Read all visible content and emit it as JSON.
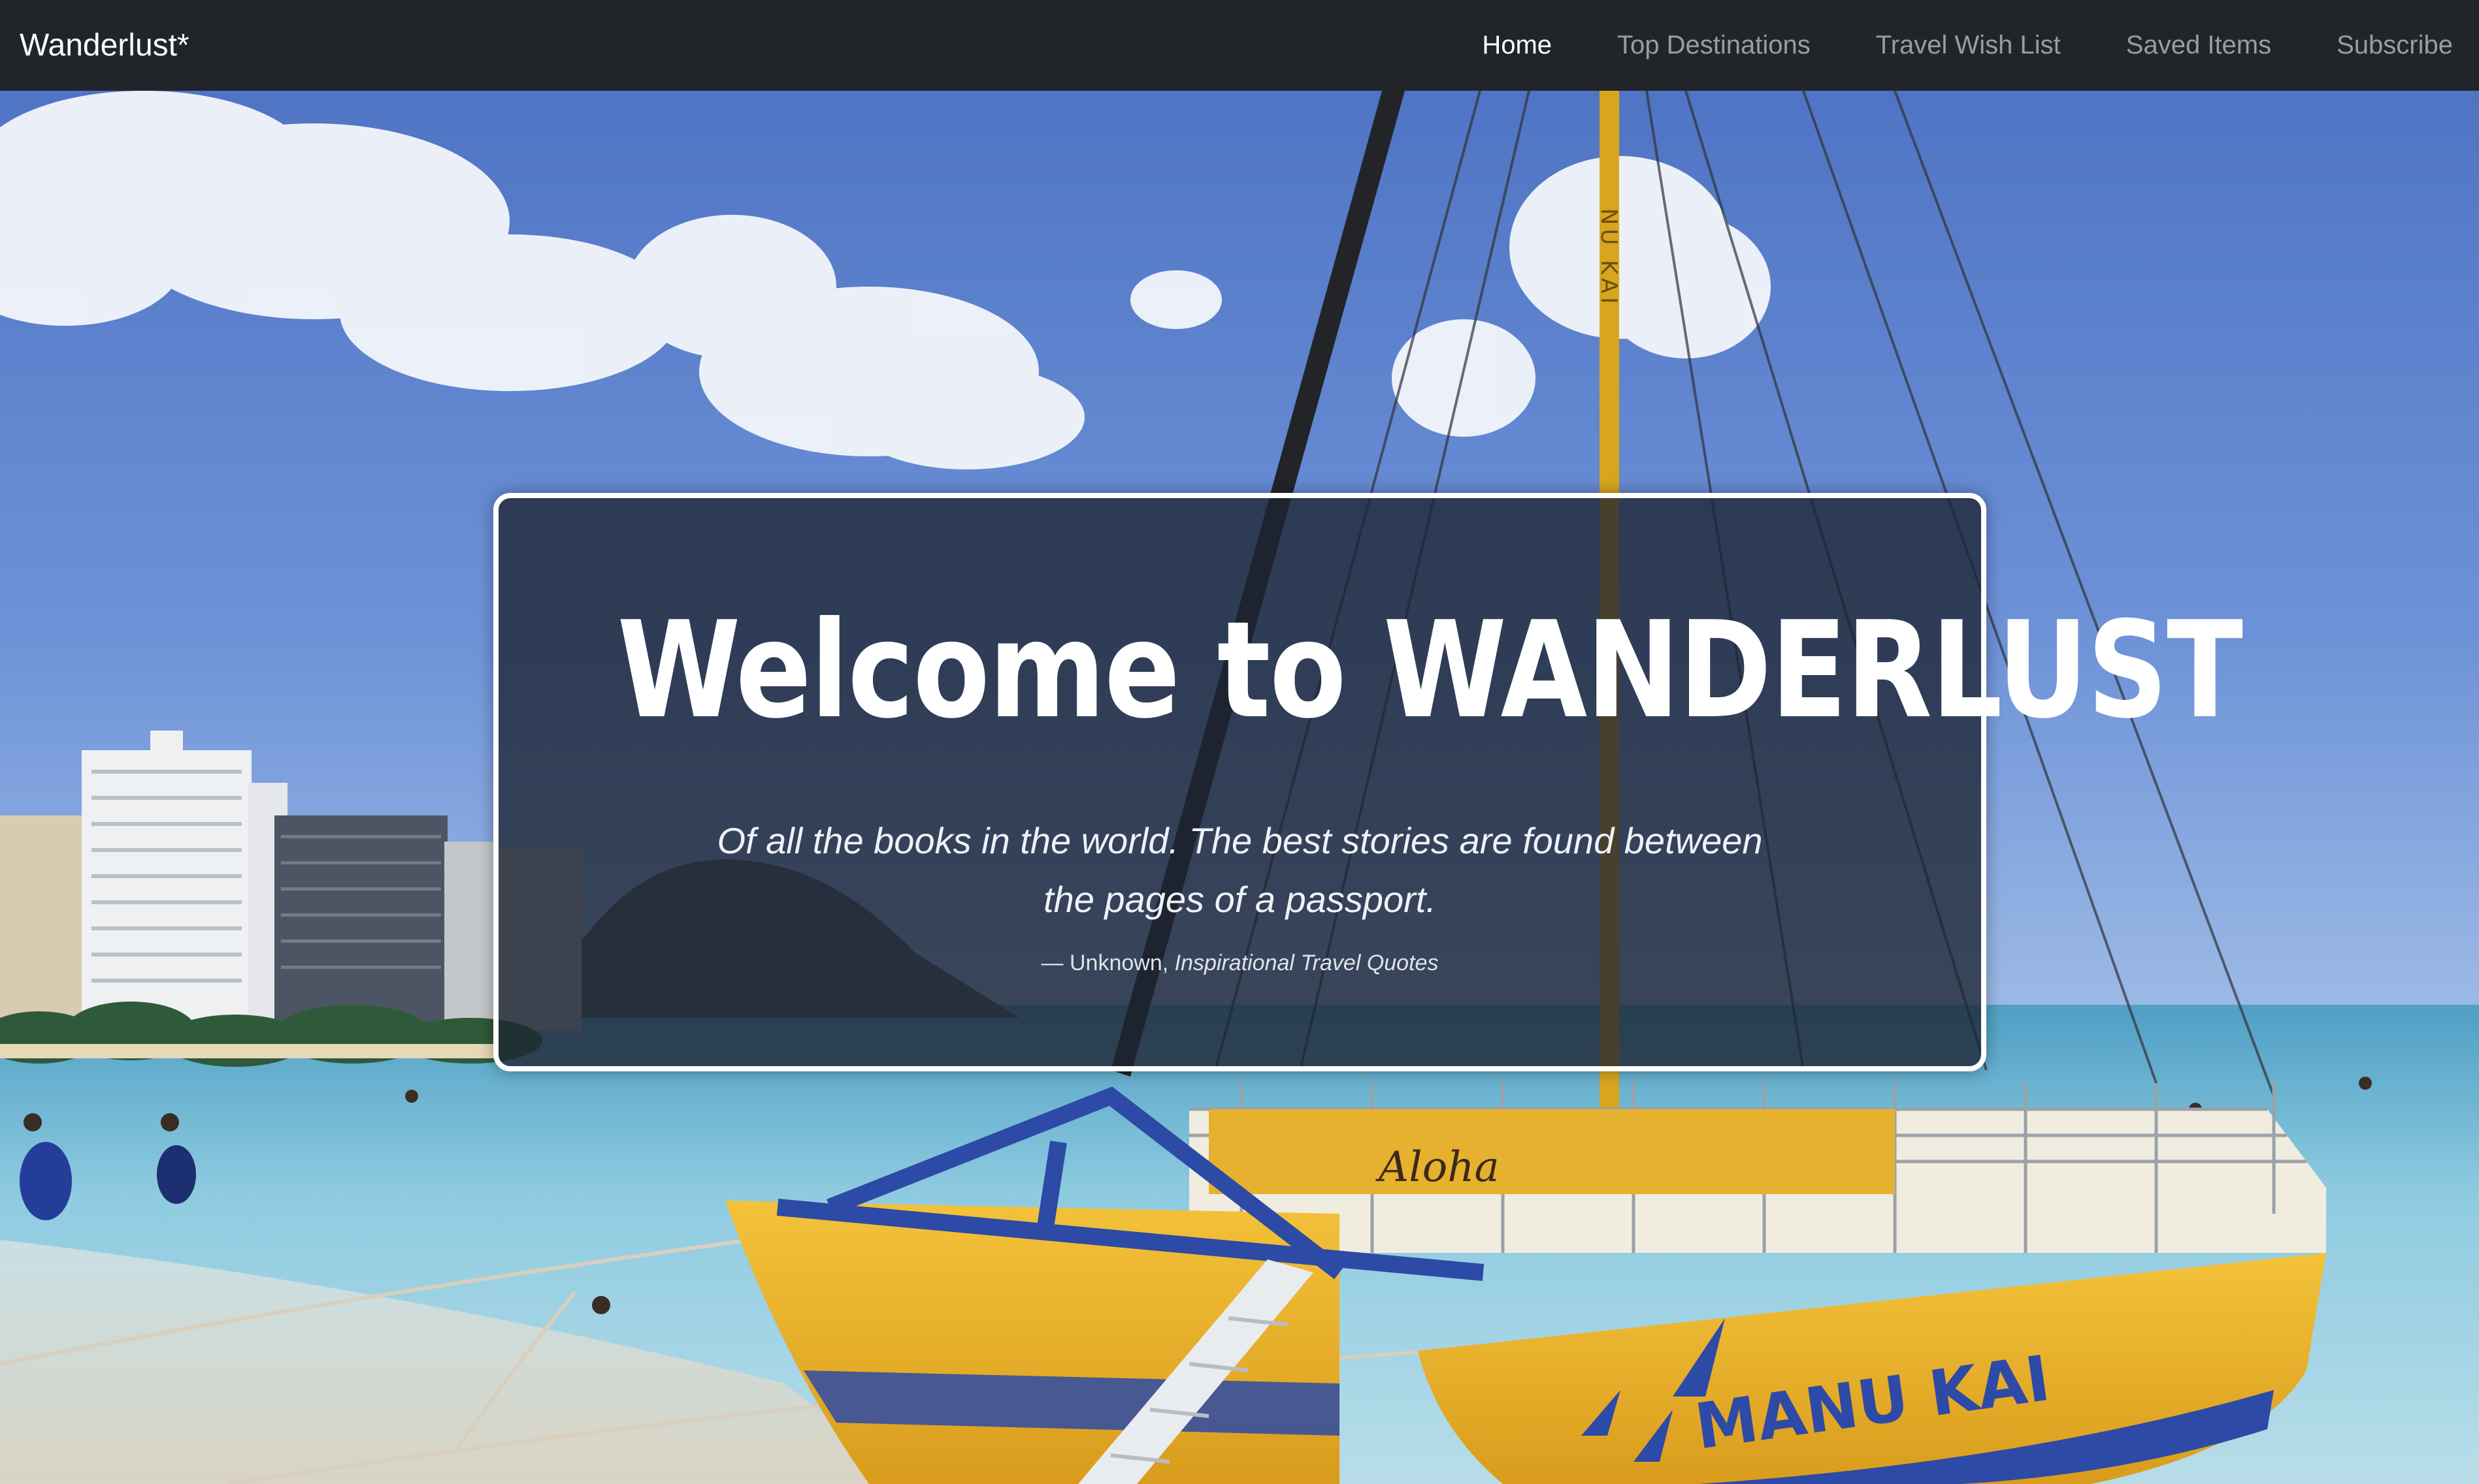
{
  "navbar": {
    "brand": "Wanderlust*",
    "items": [
      {
        "label": "Home",
        "active": true
      },
      {
        "label": "Top Destinations",
        "active": false
      },
      {
        "label": "Travel Wish List",
        "active": false
      },
      {
        "label": "Saved Items",
        "active": false
      },
      {
        "label": "Subscribe",
        "active": false
      }
    ]
  },
  "hero": {
    "title": "Welcome to WANDERLUST",
    "quote": "Of all the books in the world. The best stories are found between the pages of a passport.",
    "quote_dash": "—",
    "quote_author": "Unknown,",
    "quote_source": "Inspirational Travel Quotes",
    "boat_name": "MANU KAI",
    "boat_script": "Aloha",
    "mast_text": "NU KAI"
  },
  "colors": {
    "navbar_bg": "#212529",
    "nav_active": "#ffffff",
    "nav_inactive": "rgba(255,255,255,0.55)",
    "sky": "#5a82cf",
    "sea": "#8fc6dc",
    "hull": "#e9b12a",
    "hull_trim": "#2d4aa6"
  }
}
